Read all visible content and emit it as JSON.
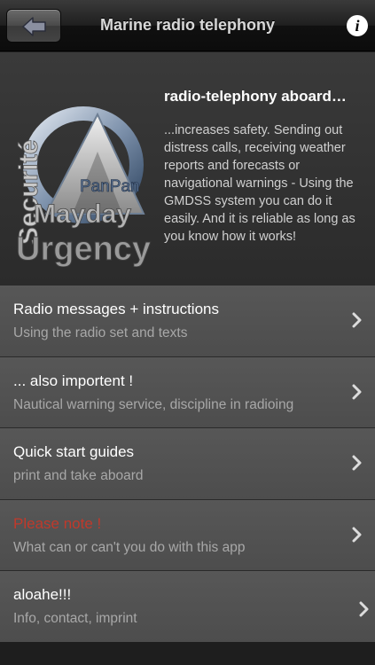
{
  "navbar": {
    "title": "Marine radio telephony",
    "back_icon": "back-arrow-icon",
    "info_label": "i"
  },
  "hero": {
    "logo_words": [
      "Securité",
      "PanPan",
      "Mayday",
      "Urgency"
    ],
    "title": "radio-telephony aboard…",
    "text": "...increases safety. Sending out distress calls, receiving weather reports and forecasts or navigational warnings - Using the GMDSS system you can do it easily. And it is reliable as long as you know how it works!"
  },
  "menu": [
    {
      "title": "Radio messages + instructions",
      "subtitle": "Using the radio set and texts"
    },
    {
      "title": "... also importent !",
      "subtitle": "Nautical warning service, discipline in radioing"
    },
    {
      "title": "Quick start guides",
      "subtitle": "print and take aboard"
    },
    {
      "title": "Please note !",
      "subtitle": "What can or can't you do with this app",
      "title_color": "#c0392b"
    },
    {
      "title": "aloahe!!!",
      "subtitle": "Info, contact, imprint"
    }
  ]
}
